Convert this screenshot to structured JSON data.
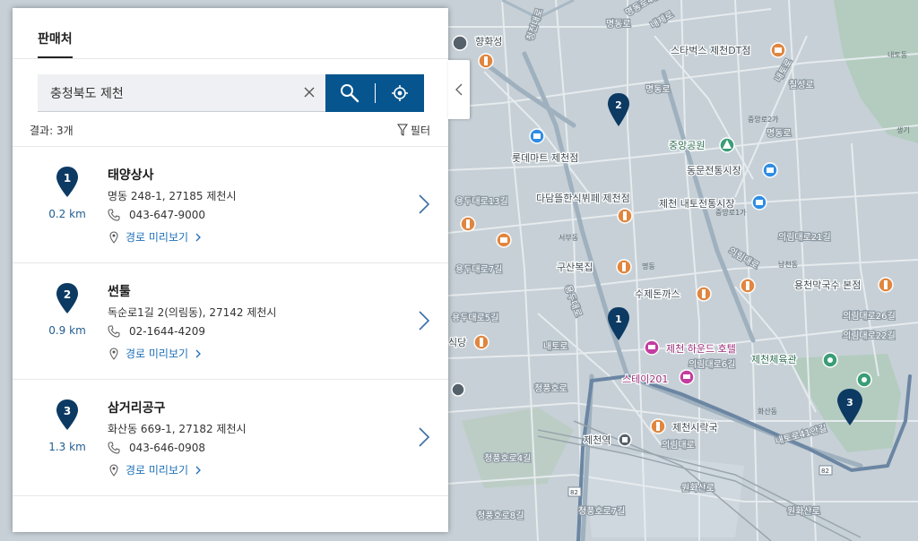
{
  "panel": {
    "title": "판매처",
    "search": {
      "value": "충청북도 제천",
      "placeholder": ""
    },
    "result_count": "결과: 3개",
    "filter_label": "필터"
  },
  "stores": [
    {
      "number": "1",
      "distance": "0.2 km",
      "name": "태양상사",
      "address": "명동 248-1, 27185 제천시",
      "phone": "043-647-9000",
      "route_label": "경로 미리보기"
    },
    {
      "number": "2",
      "distance": "0.9 km",
      "name": "썬툴",
      "address": "독순로1길 2(의림동), 27142 제천시",
      "phone": "02-1644-4209",
      "route_label": "경로 미리보기"
    },
    {
      "number": "3",
      "distance": "1.3 km",
      "name": "삼거리공구",
      "address": "화산동 669-1, 27182 제천시",
      "phone": "043-646-0908",
      "route_label": "경로 미리보기"
    }
  ],
  "map": {
    "pois": {
      "starbucks": "스타벅스 제천DT점",
      "jungang_park": "중앙공원",
      "dongmun_market": "동문전통시장",
      "lotte_mart": "롯데마트 제천점",
      "dadam": "다담뜰한식뷔페 제천점",
      "naeto_market": "제천 내토전통시장",
      "gusan": "구산복집",
      "suje": "수제돈까스",
      "yongcheon": "용천막국수 본점",
      "howood": "제천 하운드 호텔",
      "stay201": "스테이201",
      "gym": "제천체육관",
      "sirak": "제천시락국",
      "jecheon_station": "제천역",
      "hyangwonseong": "향화성",
      "sikdang": "식당"
    },
    "roads": {
      "cheongjeon": "청전대로",
      "myeongdong": "명동로",
      "myeongdong_4": "명동로4길",
      "naeje": "내제로",
      "naeto": "내토로",
      "yongdu": "용두대로",
      "yongdu_13": "용두대로13길",
      "yongdu_7": "용두대로7길",
      "yongdu_5": "용두대로5길",
      "uirim": "의림대로",
      "uirim_21": "의림대로21길",
      "uirim_6": "의림대로6길",
      "uirim_26": "의림대로26길",
      "uirim_22": "의림대로22길",
      "naeto_41": "내토로41안길",
      "cheongpung": "청풍호로",
      "cheongpung_4": "청풍호로4길",
      "cheongpung_7": "청풍호로7길",
      "cheongpung_8": "청풍호로8길",
      "wonhwasan": "원화산로",
      "chilseong": "칠성로",
      "naeto_dong": "내토동",
      "hwasan": "화산동",
      "seobu": "서부동",
      "myeong": "명동",
      "namcheon": "남천동",
      "jungang_2": "중앙로2가",
      "jungang_1": "중앙로1가",
      "naebu": "내부로",
      "saengno": "생기",
      "route82": "82"
    },
    "markers": [
      "1",
      "2",
      "3"
    ]
  },
  "colors": {
    "brand": "#06558e",
    "marker": "#0c3a63",
    "distance": "#225d90",
    "link": "#1d6fb8",
    "map_bg": "#c6d0d6",
    "poi_food": "#e0863f",
    "poi_shop": "#2f8de4",
    "poi_hotel": "#c33d9f",
    "poi_park": "#3a9d78"
  }
}
